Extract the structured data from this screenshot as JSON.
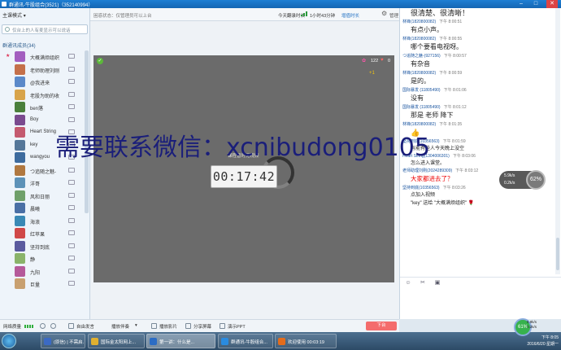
{
  "window": {
    "title": "群通讯-牛股组合(3521)（352140994）",
    "min": "–",
    "max": "□",
    "close": "✕"
  },
  "left": {
    "mode_label": "主课模式",
    "promo_text": "仅台上的人有麦显示可以说话",
    "members_header": "群通讯成员(34)",
    "members": [
      {
        "name": "大概满烦组织",
        "color": "#a35fbf",
        "role": "★"
      },
      {
        "name": "老师助理刘刚",
        "color": "#c4704a",
        "role": ""
      },
      {
        "name": "@我进来",
        "color": "#5b89c9",
        "role": ""
      },
      {
        "name": "老股为助的收",
        "color": "#d8a44a",
        "role": ""
      },
      {
        "name": "ben落",
        "color": "#4a7f3b",
        "role": ""
      },
      {
        "name": "Boy",
        "color": "#7a4a8f",
        "role": ""
      },
      {
        "name": "Heart String",
        "color": "#c45a6f",
        "role": ""
      },
      {
        "name": "key",
        "color": "#557799",
        "role": ""
      },
      {
        "name": "wangyou",
        "color": "#3d6b9e",
        "role": ""
      },
      {
        "name": "つ追随之魅-",
        "color": "#b07840",
        "role": ""
      },
      {
        "name": "洋哥",
        "color": "#5d92b8",
        "role": ""
      },
      {
        "name": "风和日丽",
        "color": "#6fa06a",
        "role": ""
      },
      {
        "name": "晨曦",
        "color": "#4a6fa5",
        "role": ""
      },
      {
        "name": "海浪",
        "color": "#3a89b5",
        "role": ""
      },
      {
        "name": "红苹果",
        "color": "#d04848",
        "role": ""
      },
      {
        "name": "坚持到底",
        "color": "#5a5a9e",
        "role": ""
      },
      {
        "name": "静",
        "color": "#8ab36a",
        "role": ""
      },
      {
        "name": "九阳",
        "color": "#b55a9a",
        "role": ""
      },
      {
        "name": "巨量",
        "color": "#c8a070",
        "role": ""
      }
    ]
  },
  "topbar": {
    "notice": "困惑状态：仅管理员可以上台",
    "online_label": "今天翻录时长",
    "duration": "1小时43分钟",
    "link": "增值时长",
    "manage": "管理"
  },
  "video": {
    "flowers": "122",
    "hearts": "0",
    "plus": "+1",
    "tagline": "课程暂时无视频",
    "timer": "00:17:42"
  },
  "watermark": "需要联系微信：xcnibudong0105",
  "bottombar": {
    "net_label": "网络质量",
    "free_speak": "自由发言",
    "mode": "播放伴奏",
    "play_video": "播放影片",
    "share_screen": "分享屏幕",
    "play_ppt": "演示PPT",
    "exit": "下台"
  },
  "chat": {
    "messages": [
      {
        "name": "",
        "time": "",
        "body": "很清楚、很清晰！",
        "style": "bigtop"
      },
      {
        "name": "林锋(1820800082)",
        "time": "下午 8:00:51",
        "body": "有点小声。",
        "style": ""
      },
      {
        "name": "林锋(1820800082)",
        "time": "下午 8:00:55",
        "body": "哪个要看电视呀。",
        "style": ""
      },
      {
        "name": "つ追随之魅-(927156)",
        "time": "下午 8:00:57",
        "body": "有杂音",
        "style": ""
      },
      {
        "name": "林锋(1820800082)",
        "time": "下午 8:00:59",
        "body": "是的。",
        "style": ""
      },
      {
        "name": "国际暴发 (11805490)",
        "time": "下午 8:01:06",
        "body": "没有",
        "style": ""
      },
      {
        "name": "国际暴发 (11805490)",
        "time": "下午 8:01:12",
        "body": "那是 老师 降下",
        "style": ""
      },
      {
        "name": "林锋(1820800082)",
        "time": "下午 8:01:35",
        "body": "👍",
        "style": "thumb"
      },
      {
        "name": "坚持到底(10356563)",
        "time": "下午 8:01:59",
        "body": "有能有些人今天晚上没空",
        "style": "small"
      },
      {
        "name": "Heart String(1304006301)",
        "time": "下午 8:03:06",
        "body": "怎么进入课堂。",
        "style": "small"
      },
      {
        "name": "老师助理刘刚(2024289309)",
        "time": "下午 8:03:12",
        "body": "大家都进去了？",
        "style": "red"
      },
      {
        "name": "坚持到底(10356563)",
        "time": "下午 8:03:26",
        "body": "点加入视频",
        "style": "small"
      },
      {
        "name": "",
        "time": "",
        "body": "\"key\" 送给 \"大概满烦组织\" 🌹",
        "style": "small"
      }
    ]
  },
  "netwidget": {
    "up": "5.9k/s",
    "down": "0.2k/s",
    "pct": "62%"
  },
  "tray": {
    "bubble": "61%",
    "up": "5.9k/s",
    "down": "0.2k/s",
    "time": "下午 8:05",
    "date": "2016/6/20 星期一"
  },
  "taskbar": {
    "tasks": [
      {
        "label": "(原信) | 不需启...",
        "color": "#3b6ac4"
      },
      {
        "label": "国际金太阳网上...",
        "color": "#e0b030"
      },
      {
        "label": "第一讲：什么是...",
        "color": "#2b6cc4"
      },
      {
        "label": "群通讯-牛股组合...",
        "color": "#2a8be0"
      },
      {
        "label": "欢迎使用 00:03:19",
        "color": "#e36c1c"
      }
    ]
  }
}
